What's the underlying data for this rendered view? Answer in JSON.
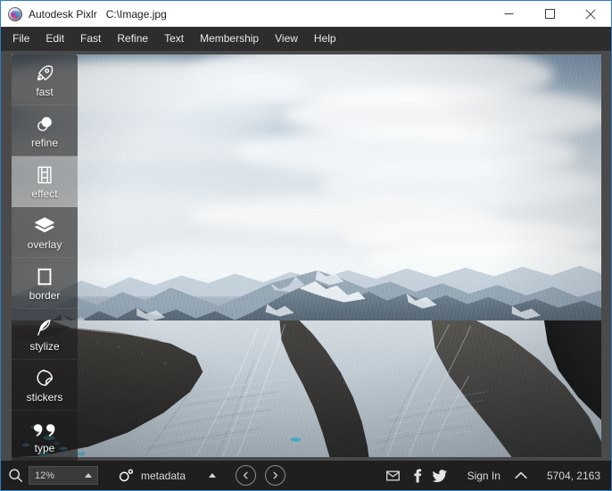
{
  "window": {
    "app_icon": "pixlr-logo-icon",
    "app_title": "Autodesk Pixlr",
    "file_path": "C:\\Image.jpg",
    "controls": {
      "minimize": "minimize-icon",
      "maximize": "maximize-icon",
      "close": "close-icon"
    }
  },
  "menubar": {
    "items": [
      {
        "label": "File"
      },
      {
        "label": "Edit"
      },
      {
        "label": "Fast"
      },
      {
        "label": "Refine"
      },
      {
        "label": "Text"
      },
      {
        "label": "Membership"
      },
      {
        "label": "View"
      },
      {
        "label": "Help"
      }
    ]
  },
  "toolpanel": {
    "items": [
      {
        "label": "fast",
        "icon": "rocket-icon",
        "hover": false
      },
      {
        "label": "refine",
        "icon": "contrast-icon",
        "hover": false
      },
      {
        "label": "effect",
        "icon": "filmstrip-icon",
        "hover": true
      },
      {
        "label": "overlay",
        "icon": "layers-icon",
        "hover": false
      },
      {
        "label": "border",
        "icon": "frame-icon",
        "hover": false
      },
      {
        "label": "stylize",
        "icon": "feather-icon",
        "hover": false
      },
      {
        "label": "stickers",
        "icon": "sticker-icon",
        "hover": false
      },
      {
        "label": "type",
        "icon": "quote-icon",
        "hover": false
      }
    ]
  },
  "canvas": {
    "image_subject": "glacier-valley-photograph"
  },
  "statusbar": {
    "search_icon": "magnifier-icon",
    "zoom_value": "12%",
    "zoom_caret": "caret-up-icon",
    "metadata_icon": "aperture-icon",
    "metadata_label": "metadata",
    "metadata_caret": "caret-up-icon",
    "prev_icon": "chevron-left-circle-icon",
    "next_icon": "chevron-right-circle-icon",
    "email_icon": "envelope-icon",
    "facebook_icon": "facebook-icon",
    "twitter_icon": "twitter-icon",
    "signin_label": "Sign In",
    "expand_icon": "chevron-up-icon",
    "dimensions": "5704, 2163"
  },
  "colors": {
    "accent_border": "#2a7fc9",
    "titlebar_bg": "#ffffff",
    "menubar_bg": "#2d2d2d",
    "statusbar_bg": "#1f1f1f",
    "workspace_bg": "#4a4a4a"
  }
}
